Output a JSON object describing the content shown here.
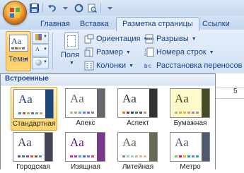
{
  "ribbon_tabs": [
    "Главная",
    "Вставка",
    "Разметка страницы",
    "Ссылки"
  ],
  "active_tab": "Разметка страницы",
  "themes_group": {
    "themes_label": "Темы"
  },
  "page_setup": {
    "fields_label": "Поля",
    "orientation_label": "Ориентация",
    "size_label": "Размер",
    "columns_label": "Колонки",
    "breaks_label": "Разрывы",
    "line_numbers_label": "Номера строк",
    "hyphenation_label": "Расстановка переносов"
  },
  "ruler": {
    "number": "5"
  },
  "gallery": {
    "header": "Встроенные",
    "themes": [
      {
        "name": "Стандартная",
        "selected": true,
        "bg": "#ffffff",
        "text": "#1f497d",
        "side": "#1f497d",
        "swatches": [
          "#4f81bd",
          "#c0504d",
          "#9bbb59",
          "#8064a2",
          "#4bacc6",
          "#f79646"
        ]
      },
      {
        "name": "Апекс",
        "selected": false,
        "bg": "#ffffff",
        "text": "#69676d",
        "side": "#69676d",
        "swatches": [
          "#ceb966",
          "#9cb084",
          "#6bb1c9",
          "#6585cf",
          "#7e6bc9",
          "#a379bb"
        ]
      },
      {
        "name": "Аспект",
        "selected": false,
        "bg": "#ffffff",
        "text": "#323232",
        "side": "#323232",
        "swatches": [
          "#f07f09",
          "#9f2936",
          "#1b587c",
          "#4e8542",
          "#604878",
          "#c19859"
        ]
      },
      {
        "name": "Бумажная",
        "selected": false,
        "bg": "#fefac9",
        "text": "#444d26",
        "side": "#444d26",
        "swatches": [
          "#a5b592",
          "#f3a447",
          "#e7bc29",
          "#d092a7",
          "#9c85c0",
          "#809ec2"
        ]
      },
      {
        "name": "Городская",
        "selected": false,
        "bg": "#ffffff",
        "text": "#424456",
        "side": "#424456",
        "swatches": [
          "#53548a",
          "#438086",
          "#a04da3",
          "#c4652d",
          "#8b5d3d",
          "#5c92b5"
        ]
      },
      {
        "name": "Изящная",
        "selected": false,
        "bg": "#ffffff",
        "text": "#5a1f6b",
        "side": "#7a3a8c",
        "swatches": [
          "#e32d91",
          "#c830cc",
          "#4ea6dc",
          "#4775e7",
          "#8971e1",
          "#d54773"
        ]
      },
      {
        "name": "Литейная",
        "selected": false,
        "bg": "#ffffff",
        "text": "#676a55",
        "side": "#676a55",
        "swatches": [
          "#72a376",
          "#b0ccb0",
          "#a8cdd7",
          "#c0beaf",
          "#cec597",
          "#e8b7b7"
        ]
      },
      {
        "name": "Метро",
        "selected": false,
        "bg": "#ffffff",
        "text": "#4e5b6f",
        "side": "#4e5b6f",
        "swatches": [
          "#7fd13b",
          "#ea157a",
          "#feb80a",
          "#00addc",
          "#738ac8",
          "#1ab39f"
        ]
      }
    ]
  },
  "colors": {
    "ribbon_text": "#15428b",
    "selection_border": "#e7a21a",
    "tab_border": "#8db2e3"
  }
}
